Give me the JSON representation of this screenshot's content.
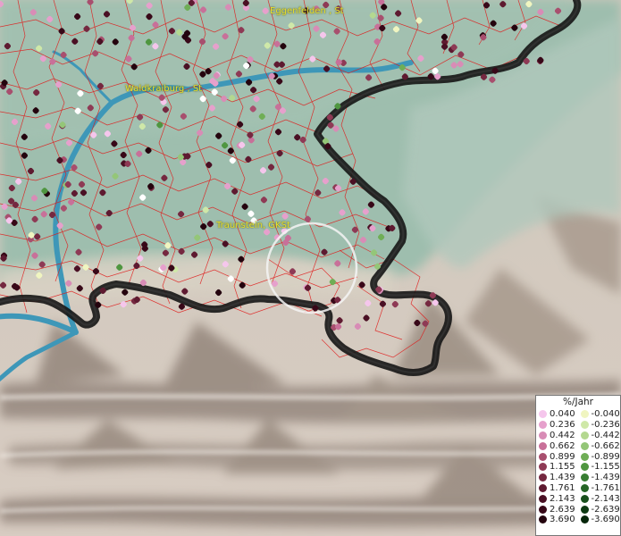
{
  "towns": [
    {
      "id": "eggenfelden",
      "label": "Eggenfelden , St"
    },
    {
      "id": "waldkraiburg",
      "label": "Waldkraiburg , St"
    },
    {
      "id": "traunstein",
      "label": "Traunstein, GKSt"
    }
  ],
  "legend": {
    "title": "%/Jahr",
    "positive": [
      {
        "value": "0.040",
        "color": "#f5c6ec"
      },
      {
        "value": "0.236",
        "color": "#e6a0cc"
      },
      {
        "value": "0.442",
        "color": "#d88cb6"
      },
      {
        "value": "0.662",
        "color": "#c87099"
      },
      {
        "value": "0.899",
        "color": "#a84f6e"
      },
      {
        "value": "1.155",
        "color": "#8e3a55"
      },
      {
        "value": "1.439",
        "color": "#752840"
      },
      {
        "value": "1.761",
        "color": "#5e1a30"
      },
      {
        "value": "2.143",
        "color": "#4a1024"
      },
      {
        "value": "2.639",
        "color": "#380818"
      },
      {
        "value": "3.690",
        "color": "#24040e"
      }
    ],
    "negative": [
      {
        "value": "-0.040",
        "color": "#f0f5c0"
      },
      {
        "value": "-0.236",
        "color": "#cfe8a8"
      },
      {
        "value": "-0.442",
        "color": "#b4d890"
      },
      {
        "value": "-0.662",
        "color": "#94c678"
      },
      {
        "value": "-0.899",
        "color": "#6fae56"
      },
      {
        "value": "-1.155",
        "color": "#4f9640"
      },
      {
        "value": "-1.439",
        "color": "#387e32"
      },
      {
        "value": "-1.761",
        "color": "#266626"
      },
      {
        "value": "-2.143",
        "color": "#18501c"
      },
      {
        "value": "-2.639",
        "color": "#0d3a12"
      },
      {
        "value": "-3.690",
        "color": "#06260a"
      }
    ]
  },
  "colors": {
    "river": "#3e97b8",
    "border": "#141414",
    "admin_lines": "#e01818",
    "plain": "#9fbdae",
    "alps": "#d6cabe"
  }
}
